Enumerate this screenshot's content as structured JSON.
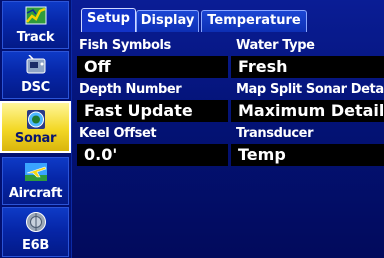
{
  "sidebar": {
    "items": [
      {
        "label": "Track",
        "icon": "track-icon"
      },
      {
        "label": "DSC",
        "icon": "dsc-icon"
      },
      {
        "label": "Sonar",
        "icon": "sonar-icon",
        "selected": true
      },
      {
        "label": "Aircraft",
        "icon": "aircraft-icon"
      },
      {
        "label": "E6B",
        "icon": "e6b-icon"
      }
    ]
  },
  "tabs": [
    {
      "label": "Setup",
      "active": true
    },
    {
      "label": "Display"
    },
    {
      "label": "Temperature"
    }
  ],
  "fields": {
    "fish_symbols": {
      "label": "Fish Symbols",
      "value": "Off"
    },
    "water_type": {
      "label": "Water Type",
      "value": "Fresh"
    },
    "depth_number": {
      "label": "Depth Number",
      "value": "Fast Update"
    },
    "map_split": {
      "label": "Map Split Sonar Detail",
      "value": "Maximum Detail"
    },
    "keel_offset": {
      "label": "Keel Offset",
      "value": "0.0'"
    },
    "transducer": {
      "label": "Transducer",
      "value": "Temp"
    }
  },
  "colors": {
    "background": "#04106e",
    "selected_item": "#f3d826",
    "field_box": "#000000",
    "text": "#ffffff"
  }
}
